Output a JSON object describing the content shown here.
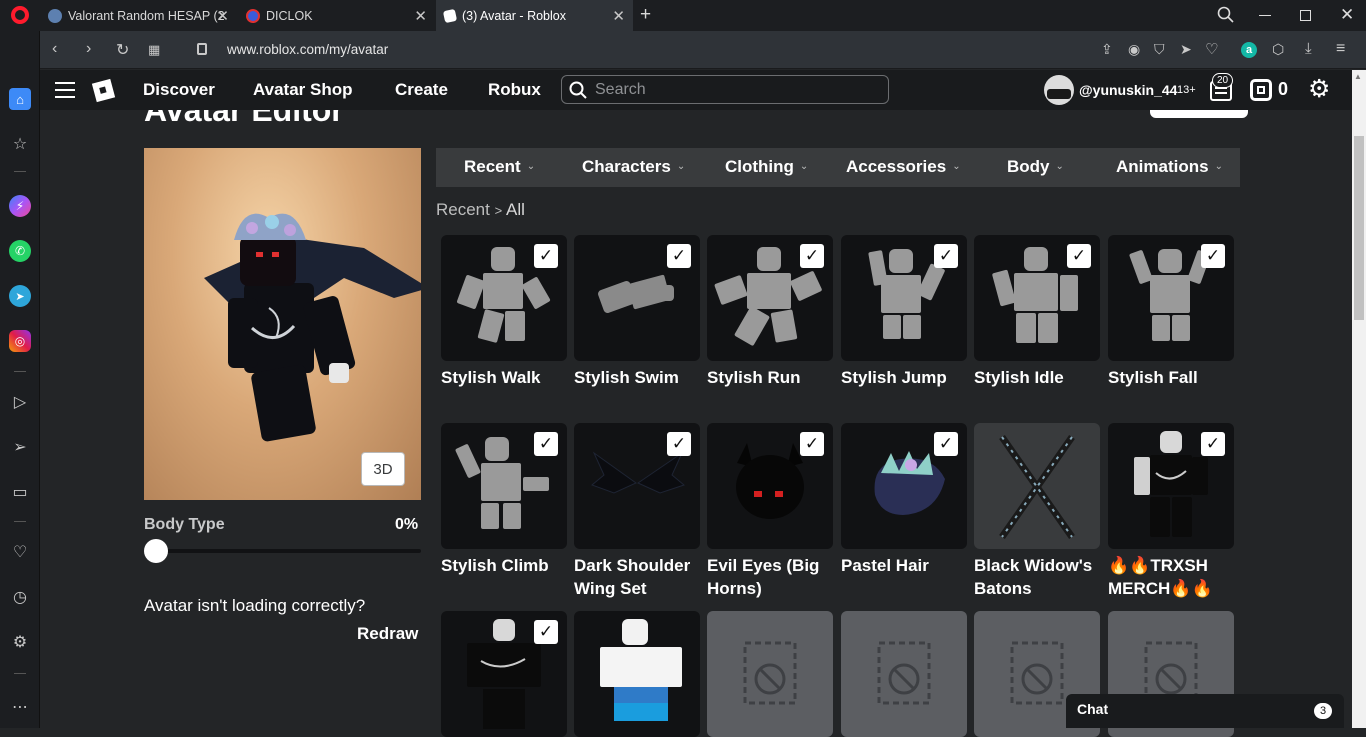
{
  "browser": {
    "tabs": [
      {
        "title": "Valorant Random HESAP (2",
        "active": false
      },
      {
        "title": "DICLOK",
        "active": false
      },
      {
        "title": "(3) Avatar - Roblox",
        "active": true
      }
    ],
    "url": "www.roblox.com/my/avatar"
  },
  "roblox_nav": {
    "links": [
      "Discover",
      "Avatar Shop",
      "Create",
      "Robux"
    ],
    "search_placeholder": "Search",
    "username": "@yunuskin_44",
    "age_tag": "13+",
    "notifications": "20",
    "robux": "0"
  },
  "page": {
    "title": "Avatar Editor",
    "btn_3d": "3D",
    "body_type_label": "Body Type",
    "body_type_value": "0%",
    "body_type_fraction": 0,
    "loading_msg": "Avatar isn't loading correctly?",
    "redraw": "Redraw"
  },
  "categories": [
    "Recent",
    "Characters",
    "Clothing",
    "Accessories",
    "Body",
    "Animations"
  ],
  "breadcrumb": {
    "parent": "Recent",
    "separator": ">",
    "current": "All"
  },
  "items": [
    {
      "name": "Stylish Walk",
      "checked": true
    },
    {
      "name": "Stylish Swim",
      "checked": true
    },
    {
      "name": "Stylish Run",
      "checked": true
    },
    {
      "name": "Stylish Jump",
      "checked": true
    },
    {
      "name": "Stylish Idle",
      "checked": true
    },
    {
      "name": "Stylish Fall",
      "checked": true
    },
    {
      "name": "Stylish Climb",
      "checked": true
    },
    {
      "name": "Dark Shoulder Wing Set",
      "checked": true
    },
    {
      "name": "Evil Eyes (Big Horns)",
      "checked": true
    },
    {
      "name": "Pastel Hair",
      "checked": true
    },
    {
      "name": "Black Widow's Batons",
      "checked": false
    },
    {
      "name": "🔥🔥TRXSH MERCH🔥🔥",
      "checked": true
    },
    {
      "name": "",
      "checked": true
    },
    {
      "name": "",
      "checked": false
    },
    {
      "name": "",
      "checked": false
    },
    {
      "name": "",
      "checked": false
    },
    {
      "name": "",
      "checked": false
    },
    {
      "name": "",
      "checked": false
    }
  ],
  "chat": {
    "label": "Chat",
    "count": "3"
  }
}
